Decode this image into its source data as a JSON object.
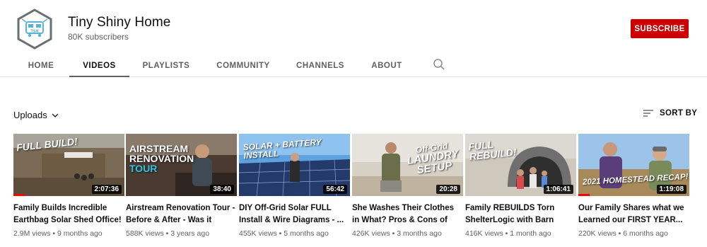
{
  "channel": {
    "name": "Tiny Shiny Home",
    "subscribers": "80K subscribers",
    "avatar_text": "TSH",
    "subscribe_label": "SUBSCRIBE"
  },
  "tabs": [
    {
      "label": "HOME",
      "active": false
    },
    {
      "label": "VIDEOS",
      "active": true
    },
    {
      "label": "PLAYLISTS",
      "active": false
    },
    {
      "label": "COMMUNITY",
      "active": false
    },
    {
      "label": "CHANNELS",
      "active": false
    },
    {
      "label": "ABOUT",
      "active": false
    }
  ],
  "uploads": {
    "label": "Uploads"
  },
  "sort": {
    "label": "SORT BY"
  },
  "videos": [
    {
      "title": "Family Builds Incredible Earthbag Solar Shed Office! ...",
      "meta": "2.9M views • 9 months ago",
      "duration": "2:07:36",
      "overlay": "FULL BUILD!",
      "watched": 0.1
    },
    {
      "title": "Airstream Renovation Tour - Before & After - Was it Wort...",
      "meta": "588K views • 3 years ago",
      "duration": "38:40",
      "overlay_lines": [
        "AIRSTREAM",
        "RENOVATION",
        "TOUR"
      ],
      "watched": 0
    },
    {
      "title": "DIY Off-Grid Solar FULL Install & Wire Diagrams - ...",
      "meta": "455K views • 5 months ago",
      "duration": "56:42",
      "overlay": "SOLAR + BATTERY INSTALL",
      "watched": 0
    },
    {
      "title": "She Washes Their Clothes in What? Pros & Cons of Off-...",
      "meta": "426K views • 3 months ago",
      "duration": "20:28",
      "overlay_lines": [
        "Off-Grid",
        "LAUNDRY",
        "SETUP"
      ],
      "watched": 0
    },
    {
      "title": "Family REBUILDS Torn ShelterLogic with Barn Door...",
      "meta": "416K views • 1 month ago",
      "duration": "1:06:41",
      "overlay_lines": [
        "FULL",
        "REBUILD!"
      ],
      "watched": 0
    },
    {
      "title": "Our Family Shares what we Learned our FIRST YEAR...",
      "meta": "220K views • 6 months ago",
      "duration": "1:19:08",
      "overlay": "2021 HOMESTEAD RECAP!",
      "watched": 0.1
    }
  ],
  "colors": {
    "subscribe": "#cc0000",
    "progress": "#ff0000",
    "avatar_accent": "#5ab3d6"
  }
}
